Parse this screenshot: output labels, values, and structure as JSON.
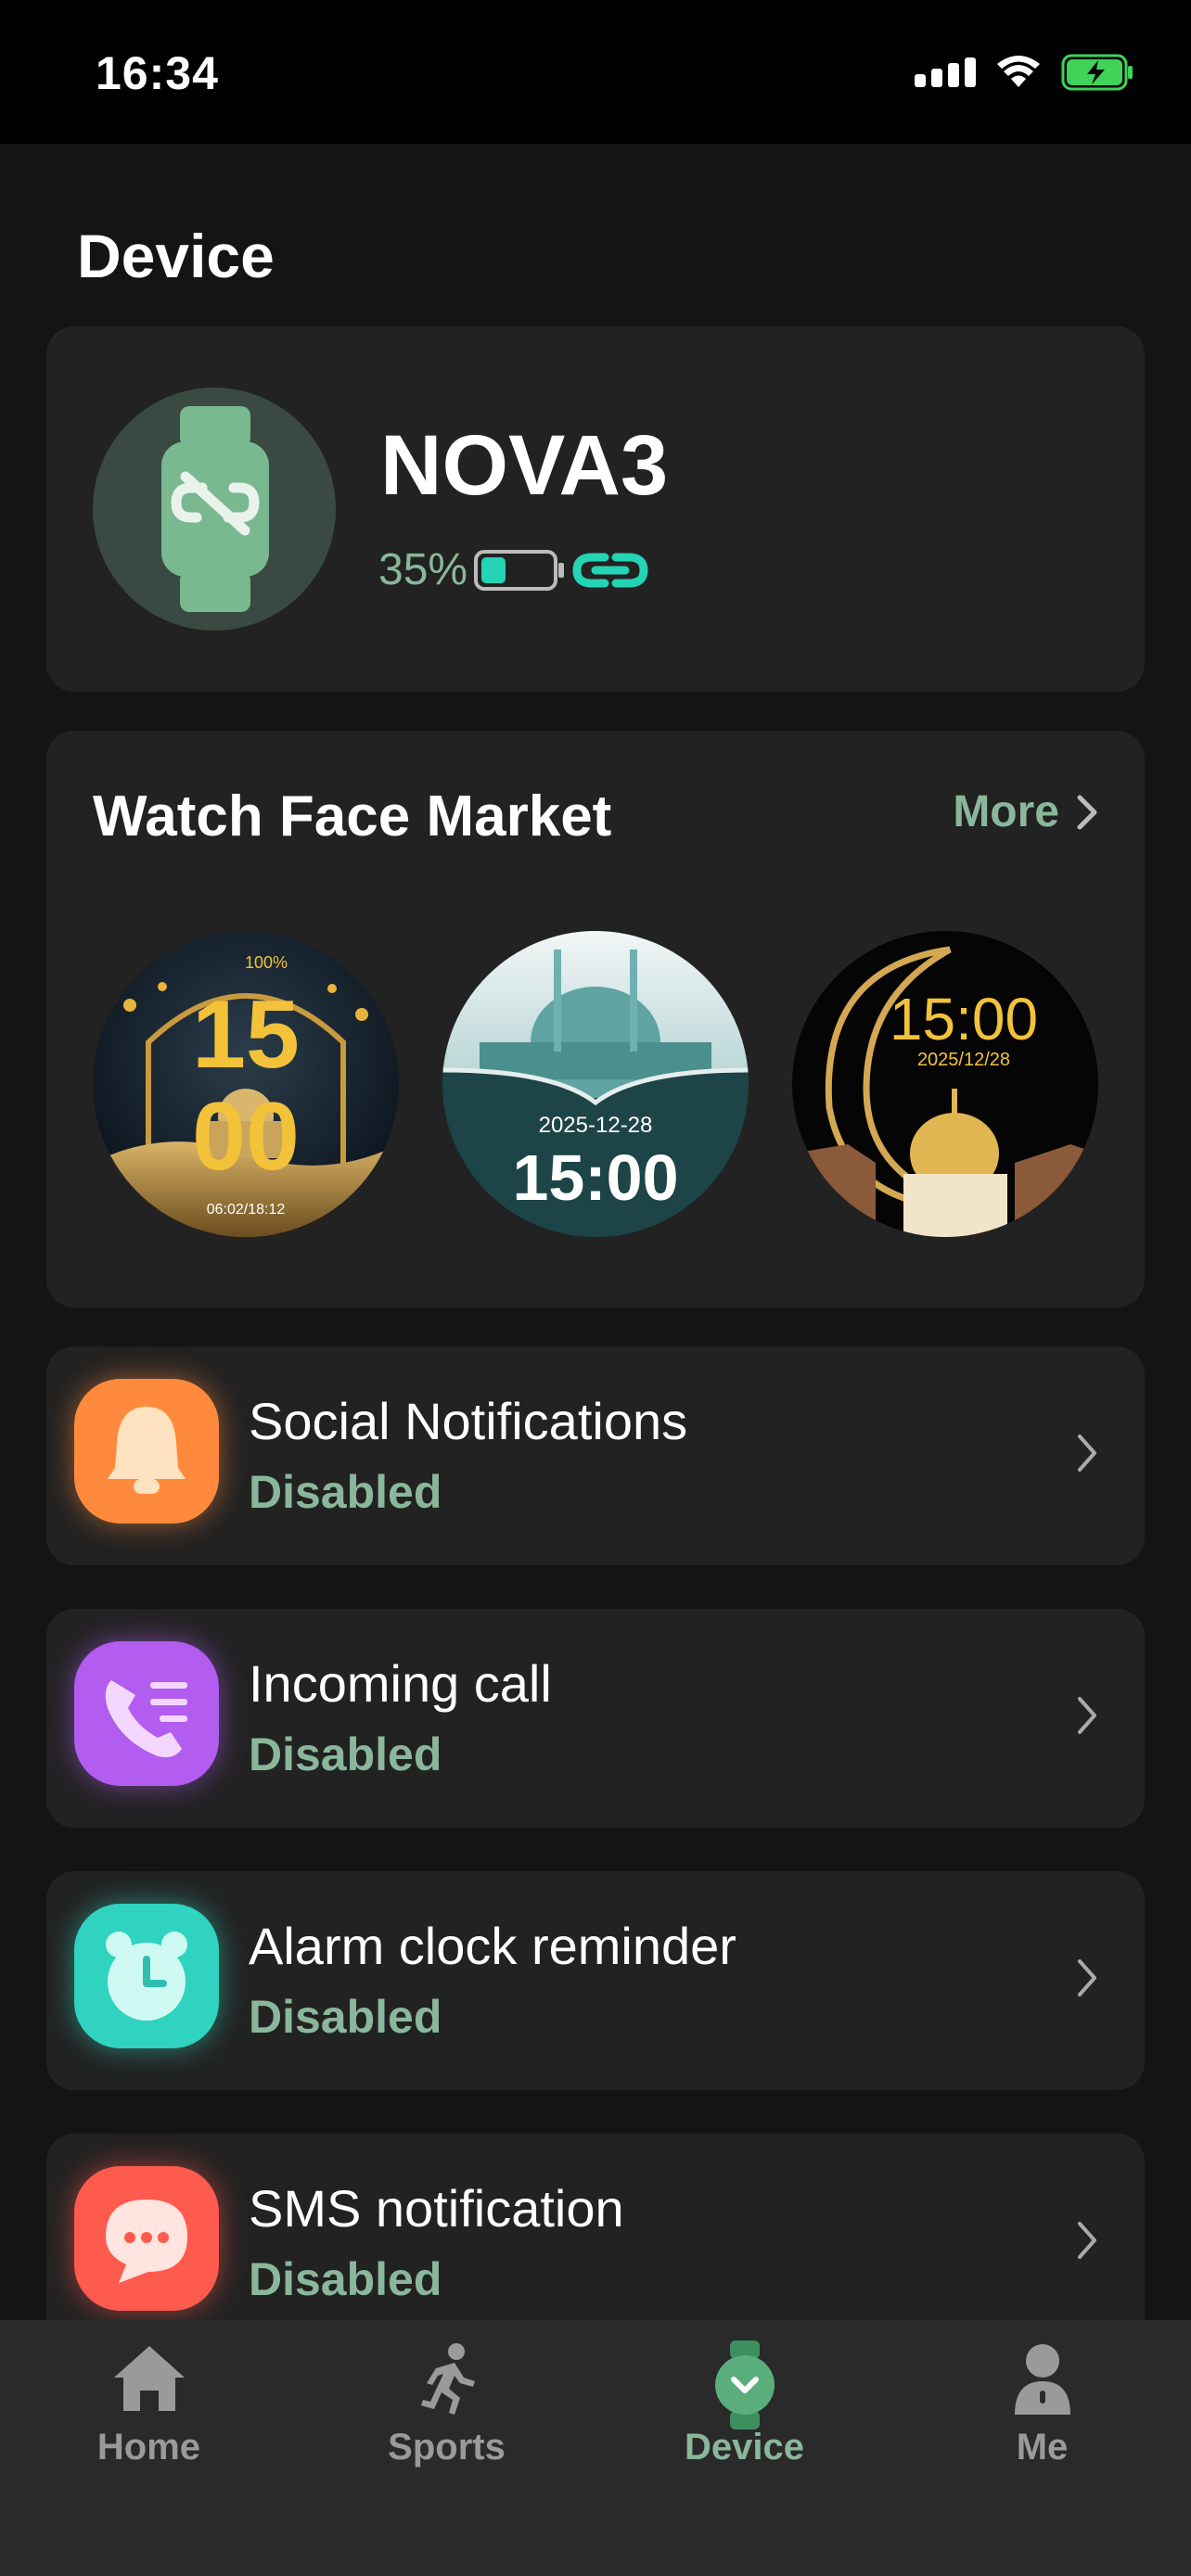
{
  "status_bar": {
    "time": "16:34"
  },
  "page_title": "Device",
  "device": {
    "name": "NOVA3",
    "battery": "35%",
    "battery_level": 0.35
  },
  "market": {
    "title": "Watch Face Market",
    "more_label": "More",
    "faces": [
      {
        "top_text": "100%",
        "time_top": "15",
        "time_bottom": "00",
        "footer": "06:02/18:12"
      },
      {
        "date": "2025-12-28",
        "time": "15:00"
      },
      {
        "time": "15:00",
        "date": "2025/12/28"
      }
    ]
  },
  "settings": [
    {
      "title": "Social Notifications",
      "status": "Disabled",
      "icon": "bell-icon",
      "color": "#ff8a3d"
    },
    {
      "title": "Incoming call",
      "status": "Disabled",
      "icon": "phone-icon",
      "color": "#b25cf0"
    },
    {
      "title": "Alarm clock reminder",
      "status": "Disabled",
      "icon": "alarm-clock-icon",
      "color": "#2fd3c0"
    },
    {
      "title": "SMS notification",
      "status": "Disabled",
      "icon": "chat-bubble-icon",
      "color": "#ff5a4e"
    }
  ],
  "tabs": [
    {
      "label": "Home",
      "icon": "home-icon"
    },
    {
      "label": "Sports",
      "icon": "runner-icon"
    },
    {
      "label": "Device",
      "icon": "watch-icon",
      "active": true
    },
    {
      "label": "Me",
      "icon": "person-icon"
    }
  ],
  "colors": {
    "accent": "#8ab79b",
    "link": "#25d3b5",
    "card": "#222222",
    "background": "#141414"
  }
}
